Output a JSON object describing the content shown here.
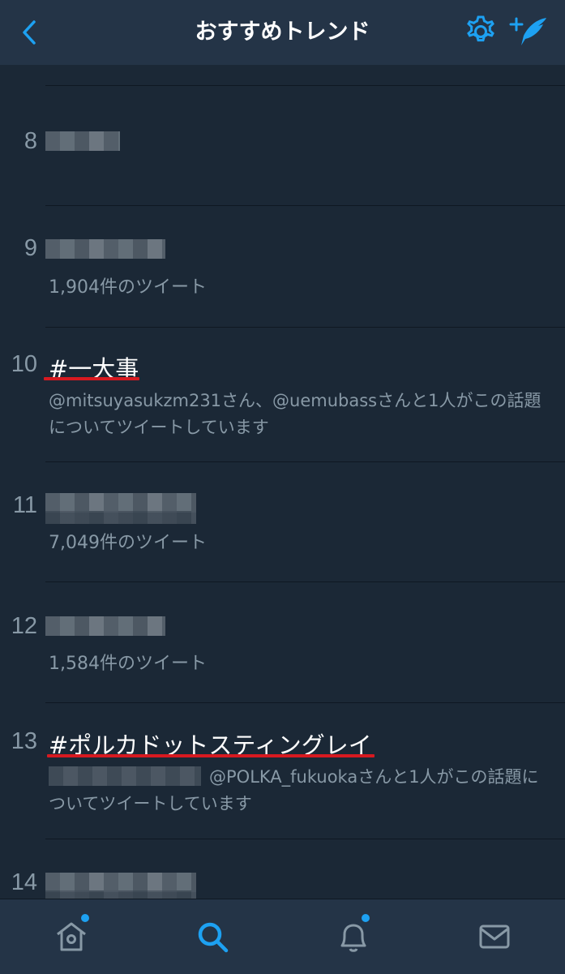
{
  "header": {
    "title": "おすすめトレンド",
    "back_icon": "chevron-left-icon",
    "settings_icon": "gear-icon",
    "compose_icon": "compose-quill-icon",
    "accent_color": "#1da1f2"
  },
  "trends": [
    {
      "rank": "8",
      "name": "",
      "meta": ""
    },
    {
      "rank": "9",
      "name": "",
      "meta": "1,904件のツイート"
    },
    {
      "rank": "10",
      "name": "#一大事",
      "meta": "@mitsuyasukzm231さん、@uemubassさんと1人がこの話題についてツイートしています"
    },
    {
      "rank": "11",
      "name": "",
      "meta": "7,049件のツイート"
    },
    {
      "rank": "12",
      "name": "",
      "meta": "1,584件のツイート"
    },
    {
      "rank": "13",
      "name": "#ポルカドットスティングレイ",
      "meta": "@POLKA_fukuokaさんと1人がこの話題についてツイートしています"
    },
    {
      "rank": "14",
      "name": "",
      "meta": ""
    }
  ],
  "tabbar": {
    "home_icon": "home-icon",
    "search_icon": "search-icon",
    "notifications_icon": "bell-icon",
    "messages_icon": "mail-icon"
  }
}
